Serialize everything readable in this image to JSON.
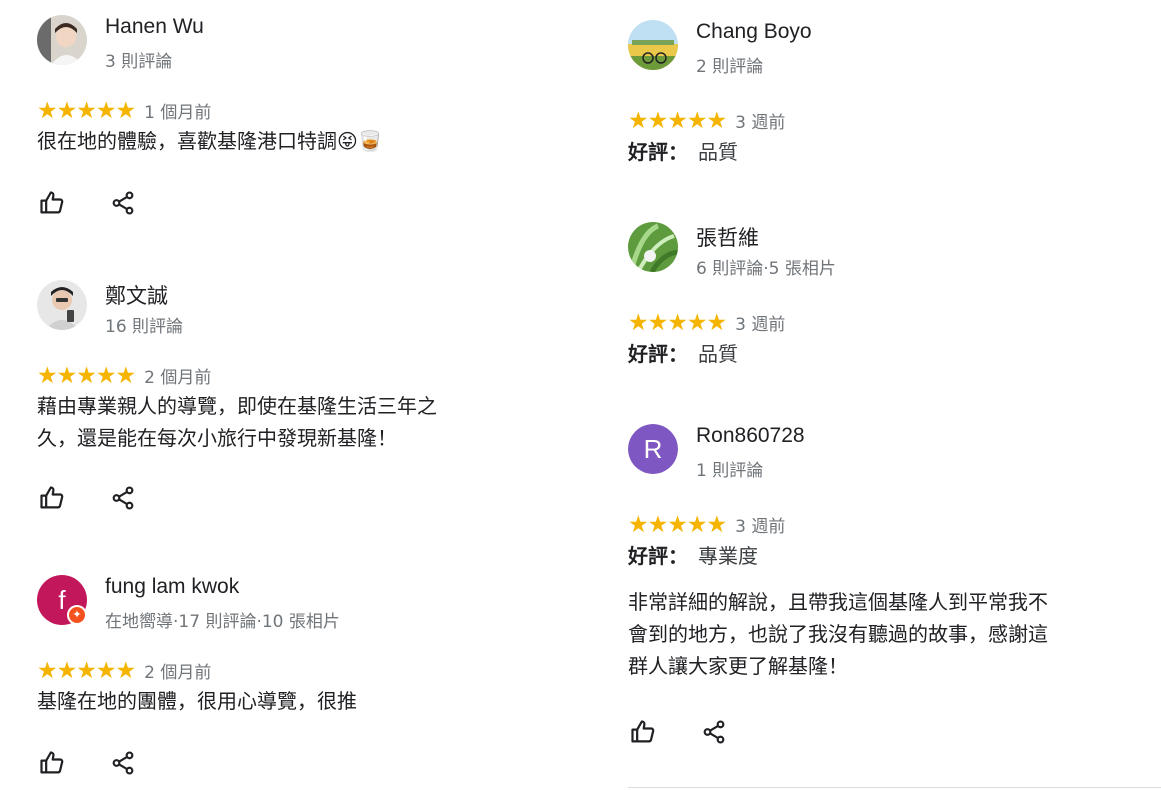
{
  "icons": {
    "like": "thumbs-up-icon",
    "share": "share-icon",
    "star": "star-icon",
    "guide_badge": "local-guide-badge-icon"
  },
  "colors": {
    "star": "#f4b400",
    "meta_text": "#70757a",
    "avatar_f": "#c2185b",
    "avatar_r": "#7e57c2",
    "guide_badge": "#f4511e"
  },
  "left_reviews": [
    {
      "author": "Hanen Wu",
      "meta": "3 則評論",
      "stars": "★★★★★",
      "rating": 5,
      "time": "1 個月前",
      "text": "很在地的體驗，喜歡基隆港口特調😝🥃"
    },
    {
      "author": "鄭文誠",
      "meta": "16 則評論",
      "stars": "★★★★★",
      "rating": 5,
      "time": "2 個月前",
      "text_lines": [
        "藉由專業親人的導覽，即使在基隆生活三年之",
        "久，還是能在每次小旅行中發現新基隆！"
      ]
    },
    {
      "author": "fung lam kwok",
      "avatar_letter": "f",
      "meta": "在地嚮導·17 則評論·10 張相片",
      "stars": "★★★★★",
      "rating": 5,
      "time": "2 個月前",
      "text": "基隆在地的團體，很用心導覽，很推"
    }
  ],
  "right_reviews": [
    {
      "author": "Chang Boyo",
      "meta": "2 則評論",
      "stars": "★★★★★",
      "rating": 5,
      "time": "3 週前",
      "aspect_label": "好評：",
      "aspect_value": "品質"
    },
    {
      "author": "張哲維",
      "meta": "6 則評論·5 張相片",
      "stars": "★★★★★",
      "rating": 5,
      "time": "3 週前",
      "aspect_label": "好評：",
      "aspect_value": "品質"
    },
    {
      "author": "Ron860728",
      "avatar_letter": "R",
      "meta": "1 則評論",
      "stars": "★★★★★",
      "rating": 5,
      "time": "3 週前",
      "aspect_label": "好評：",
      "aspect_value": "專業度",
      "text_lines": [
        "非常詳細的解說，且帶我這個基隆人到平常我不",
        "會到的地方，也說了我沒有聽過的故事，感謝這",
        "群人讓大家更了解基隆！"
      ]
    }
  ]
}
